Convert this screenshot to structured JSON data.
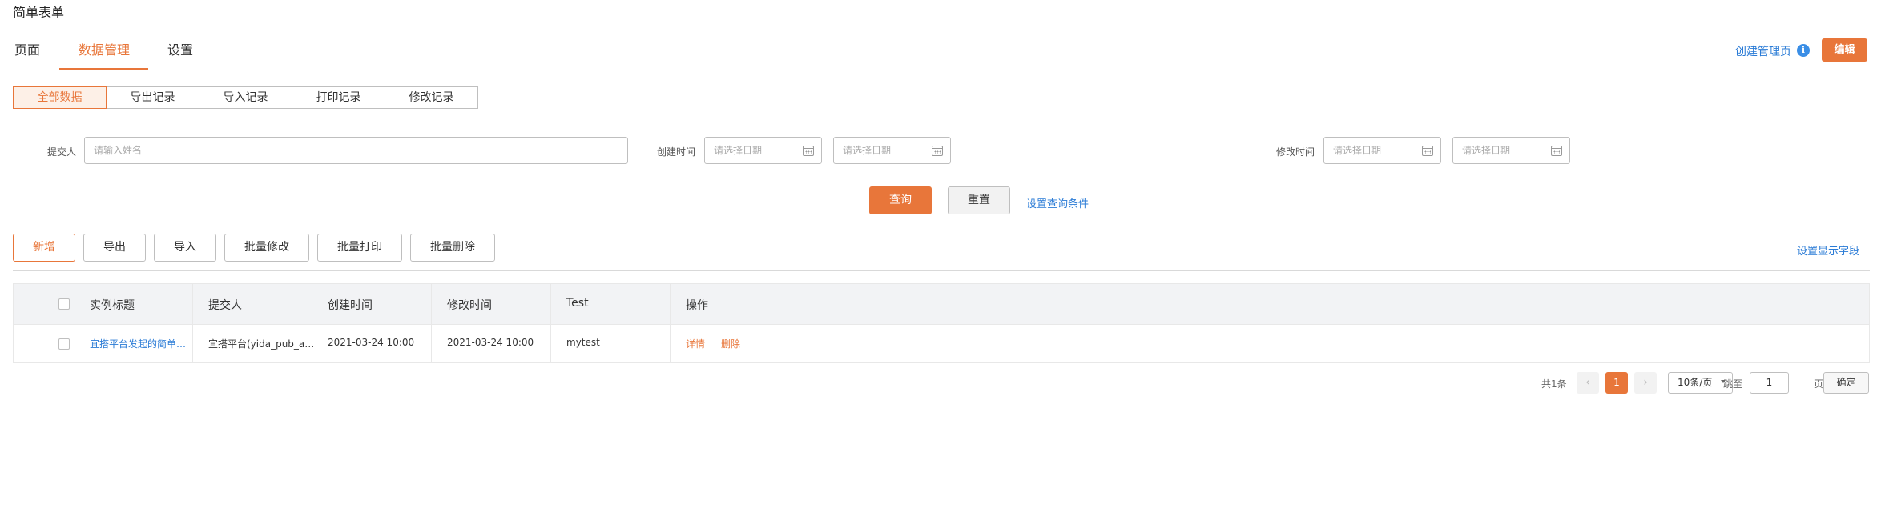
{
  "app": {
    "title": "简单表单"
  },
  "nav": {
    "tabs": [
      {
        "label": "页面"
      },
      {
        "label": "数据管理"
      },
      {
        "label": "设置"
      }
    ],
    "create_admin_label": "创建管理页",
    "info_glyph": "i",
    "edit_label": "编辑"
  },
  "segments": [
    {
      "label": "全部数据"
    },
    {
      "label": "导出记录"
    },
    {
      "label": "导入记录"
    },
    {
      "label": "打印记录"
    },
    {
      "label": "修改记录"
    }
  ],
  "filters": {
    "submitter_label": "提交人",
    "submitter_placeholder": "请输入姓名",
    "created_label": "创建时间",
    "modified_label": "修改时间",
    "date_placeholder": "请选择日期",
    "range_sep": "-"
  },
  "query": {
    "search_label": "查询",
    "reset_label": "重置",
    "set_conditions_label": "设置查询条件"
  },
  "actions": {
    "add": "新增",
    "export": "导出",
    "import": "导入",
    "batch_edit": "批量修改",
    "batch_print": "批量打印",
    "batch_delete": "批量删除",
    "set_fields": "设置显示字段"
  },
  "table": {
    "headers": [
      "实例标题",
      "提交人",
      "创建时间",
      "修改时间",
      "Test",
      "操作"
    ],
    "rows": [
      {
        "title": "宜搭平台发起的简单…",
        "submitter": "宜搭平台(yida_pub_a…",
        "created": "2021-03-24 10:00",
        "modified": "2021-03-24 10:00",
        "test": "mytest",
        "detail": "详情",
        "delete": "删除"
      }
    ]
  },
  "pagination": {
    "total": "共1条",
    "prev": "‹",
    "current": "1",
    "next": "›",
    "page_size": "10条/页",
    "jump_label": "跳至",
    "jump_value": "1",
    "page_suffix": "页",
    "confirm": "确定"
  },
  "colors": {
    "accent": "#e8763a",
    "link": "#2a7bd6"
  }
}
